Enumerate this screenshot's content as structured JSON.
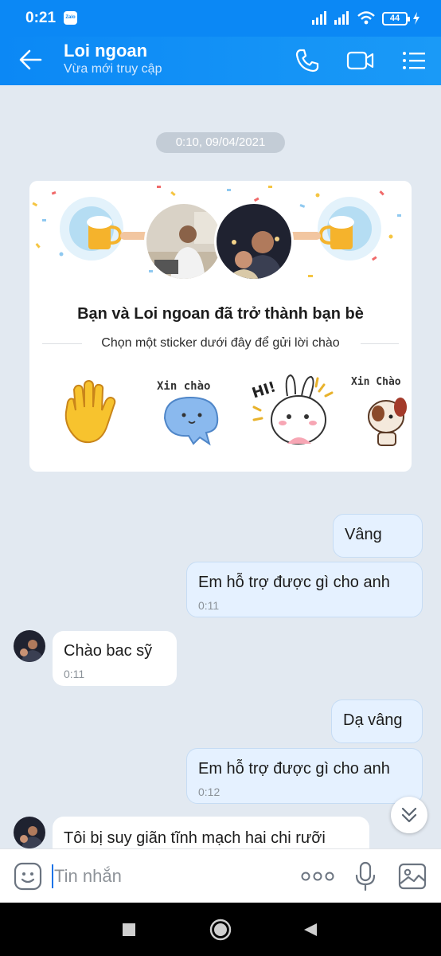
{
  "status": {
    "time": "0:21",
    "app_badge": "Zalo",
    "battery": "44"
  },
  "header": {
    "name": "Loi ngoan",
    "subtitle": "Vừa mới truy cập",
    "icons": [
      "back-arrow-icon",
      "phone-icon",
      "video-icon",
      "menu-list-icon"
    ]
  },
  "chat": {
    "timestamp": "0:10, 09/04/2021",
    "friend_card": {
      "title": "Bạn và Loi ngoan đã trở thành bạn bè",
      "subtitle": "Chọn một sticker dưới đây để gửi lời chào",
      "stickers": [
        {
          "name": "waving-hand-sticker",
          "text": ""
        },
        {
          "name": "xin-chao-blob-sticker",
          "text": "Xin chào"
        },
        {
          "name": "hi-bunny-sticker",
          "text": "HI!"
        },
        {
          "name": "xin-chao-dog-sticker",
          "text": "Xin Chào"
        }
      ]
    },
    "messages": [
      {
        "dir": "out",
        "text": "Vâng",
        "time": ""
      },
      {
        "dir": "out",
        "text": "Em hỗ trợ được gì cho anh",
        "time": "0:11"
      },
      {
        "dir": "in",
        "text": "Chào bac sỹ",
        "time": "0:11"
      },
      {
        "dir": "out",
        "text": "Dạ vâng",
        "time": ""
      },
      {
        "dir": "out",
        "text": "Em hỗ trợ được gì cho anh",
        "time": "0:12"
      },
      {
        "dir": "in",
        "text": "Tôi bị suy giãn tĩnh mạch hai chi rưỡi",
        "time": ""
      }
    ]
  },
  "composer": {
    "placeholder": "Tin nhắn"
  },
  "colors": {
    "primary": "#0b88f5",
    "background": "#e2e9f1",
    "outgoing_bubble": "#e5f1ff"
  }
}
